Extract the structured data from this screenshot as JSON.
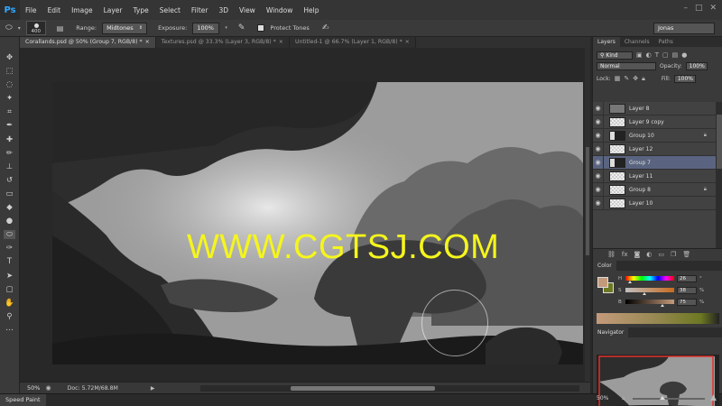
{
  "app": {
    "logo": "Ps",
    "menu": [
      "File",
      "Edit",
      "Image",
      "Layer",
      "Type",
      "Select",
      "Filter",
      "3D",
      "View",
      "Window",
      "Help"
    ],
    "window_controls": [
      "–",
      "□",
      "✕"
    ]
  },
  "options": {
    "brush_size": "400",
    "range_label": "Range:",
    "range_value": "Midtones",
    "exposure_label": "Exposure:",
    "exposure_value": "100%",
    "protect_tones_label": "Protect Tones",
    "workspace": "Jonas"
  },
  "tabs": [
    {
      "label": "Corallands.psd @ 50% (Group 7, RGB/8) *",
      "active": true
    },
    {
      "label": "Textures.psd @ 33.3% (Layer 3, RGB/8) *",
      "active": false
    },
    {
      "label": "Untitled-1 @ 66.7% (Layer 1, RGB/8) *",
      "active": false
    }
  ],
  "canvas": {
    "watermark": "WWW.CGTSJ.COM"
  },
  "status": {
    "zoom": "50%",
    "doc": "Doc: 5.72M/68.8M"
  },
  "bottom": {
    "workspace_tab": "Speed Paint"
  },
  "layers_panel": {
    "tabs": [
      "Layers",
      "Channels",
      "Paths"
    ],
    "filter_kind": "Kind",
    "blend_mode": "Normal",
    "opacity_label": "Opacity:",
    "opacity_value": "100%",
    "lock_label": "Lock:",
    "fill_label": "Fill:",
    "fill_value": "100%",
    "layers": [
      {
        "name": "Layer 8",
        "thumb": "gray",
        "locked": false,
        "selected": false
      },
      {
        "name": "Layer 9 copy",
        "thumb": "checker",
        "locked": false,
        "selected": false
      },
      {
        "name": "Group 10",
        "thumb": "dark",
        "locked": true,
        "selected": false
      },
      {
        "name": "Layer 12",
        "thumb": "checker",
        "locked": false,
        "selected": false
      },
      {
        "name": "Group 7",
        "thumb": "dark",
        "locked": false,
        "selected": true
      },
      {
        "name": "Layer 11",
        "thumb": "checker",
        "locked": false,
        "selected": false
      },
      {
        "name": "Group 8",
        "thumb": "checker",
        "locked": true,
        "selected": false
      },
      {
        "name": "Layer 10",
        "thumb": "checker",
        "locked": false,
        "selected": false
      }
    ],
    "footer_icons": [
      "link-icon",
      "fx-icon",
      "mask-icon",
      "adjustment-icon",
      "folder-icon",
      "new-layer-icon",
      "trash-icon"
    ]
  },
  "color_panel": {
    "title": "Color",
    "fg_color": "#c49a7b",
    "bg_color": "#6d7822",
    "sliders": [
      {
        "label": "H",
        "value": "26",
        "unit": "°"
      },
      {
        "label": "S",
        "value": "38",
        "unit": "%"
      },
      {
        "label": "B",
        "value": "75",
        "unit": "%"
      }
    ]
  },
  "navigator": {
    "title": "Navigator",
    "zoom": "50%"
  }
}
